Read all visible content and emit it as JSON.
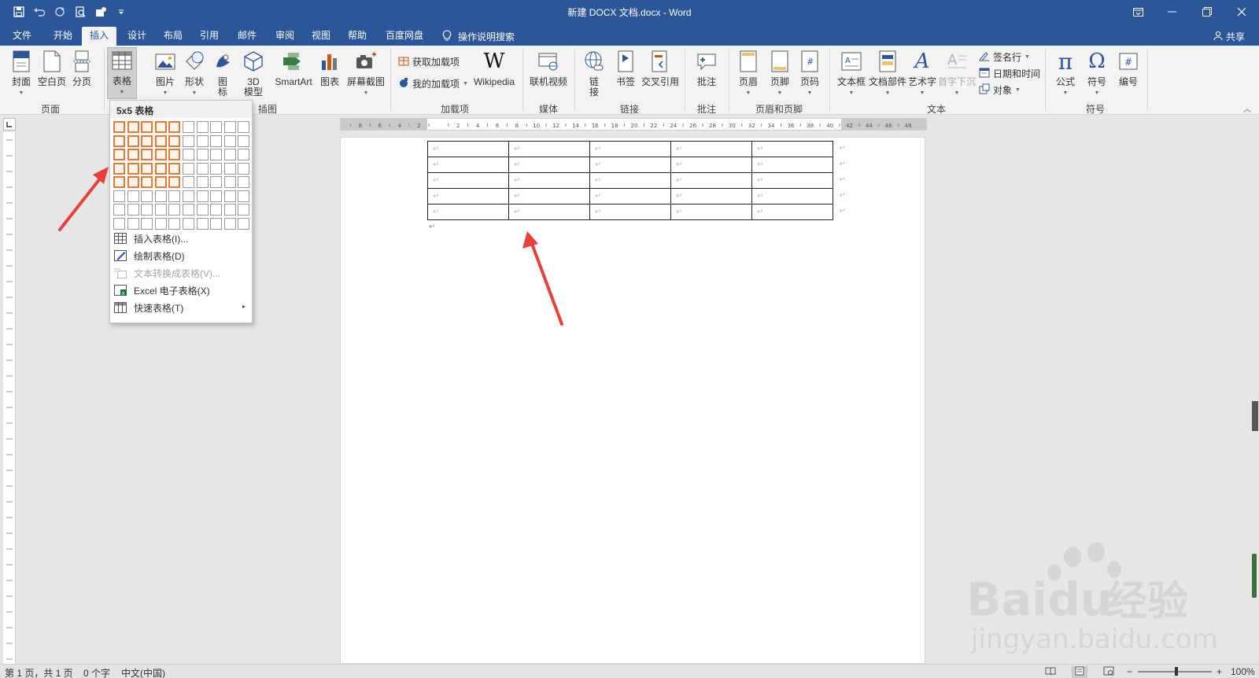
{
  "window": {
    "title": "新建 DOCX 文档.docx  -  Word",
    "controls": [
      "restore-ribbon",
      "minimize",
      "maximize",
      "close"
    ]
  },
  "tabs": [
    "文件",
    "开始",
    "插入",
    "设计",
    "布局",
    "引用",
    "邮件",
    "审阅",
    "视图",
    "帮助",
    "百度网盘"
  ],
  "active_tab": "插入",
  "tell_me": "操作说明搜索",
  "share": "共享",
  "ribbon": {
    "pages_group": {
      "label": "页面",
      "cover": "封面",
      "blank": "空白页",
      "break": "分页"
    },
    "table_group": {
      "table": "表格"
    },
    "illustrations_group": {
      "label": "插图",
      "picture": "图片",
      "shapes": "形状",
      "icons_1": "图",
      "icons_2": "标",
      "model_1": "3D",
      "model_2": "模型",
      "smartart": "SmartArt",
      "chart": "图表",
      "screenshot": "屏幕截图"
    },
    "addins_group": {
      "label": "加载项",
      "get": "获取加载项",
      "mine": "我的加载项",
      "wikipedia": "Wikipedia"
    },
    "media_group": {
      "label": "媒体",
      "video": "联机视频"
    },
    "links_group": {
      "label": "链接",
      "link_1": "链",
      "link_2": "接",
      "bookmark": "书签",
      "crossref": "交叉引用"
    },
    "comments_group": {
      "label": "批注",
      "comment": "批注"
    },
    "headerfooter_group": {
      "label": "页眉和页脚",
      "header": "页眉",
      "footer": "页脚",
      "pagenum": "页码"
    },
    "text_group": {
      "label": "文本",
      "textbox": "文本框",
      "parts": "文档部件",
      "wordart": "艺术字",
      "dropcap": "首字下沉",
      "signature": "签名行",
      "datetime": "日期和时间",
      "object": "对象"
    },
    "symbols_group": {
      "label": "符号",
      "equation": "公式",
      "symbol": "符号",
      "number": "编号"
    }
  },
  "table_dropdown": {
    "header": "5x5 表格",
    "grid_cols": 10,
    "grid_rows": 8,
    "highlight_cols": 5,
    "highlight_rows": 5,
    "items": [
      {
        "label": "插入表格(I)...",
        "enabled": true,
        "icon": "table-insert-icon"
      },
      {
        "label": "绘制表格(D)",
        "enabled": true,
        "icon": "table-draw-icon"
      },
      {
        "label": "文本转换成表格(V)...",
        "enabled": false,
        "icon": "text-to-table-icon"
      },
      {
        "label": "Excel 电子表格(X)",
        "enabled": true,
        "icon": "excel-icon"
      },
      {
        "label": "快速表格(T)",
        "enabled": true,
        "icon": "quick-table-icon",
        "submenu": "▸"
      }
    ]
  },
  "document": {
    "table_rows": 5,
    "table_cols": 5,
    "cell_mark": "↵",
    "para_mark": "↵"
  },
  "ruler": {
    "labels": [
      "8",
      "6",
      "4",
      "2",
      "",
      "2",
      "4",
      "6",
      "8",
      "10",
      "12",
      "14",
      "16",
      "18",
      "20",
      "22",
      "24",
      "26",
      "28",
      "30",
      "32",
      "34",
      "36",
      "38",
      "40",
      "42",
      "44",
      "46",
      "48"
    ]
  },
  "statusbar": {
    "page": "第 1 页，共 1 页",
    "words": "0 个字",
    "lang": "中文(中国)",
    "zoom": "100%",
    "zoom_minus": "−",
    "zoom_plus": "+"
  },
  "watermark": {
    "brand": "Baidu",
    "cn": "经验",
    "url": "jingyan.baidu.com"
  },
  "colors": {
    "accent": "#2b579a",
    "highlight": "#e07b39",
    "arrow": "#e8413c"
  }
}
